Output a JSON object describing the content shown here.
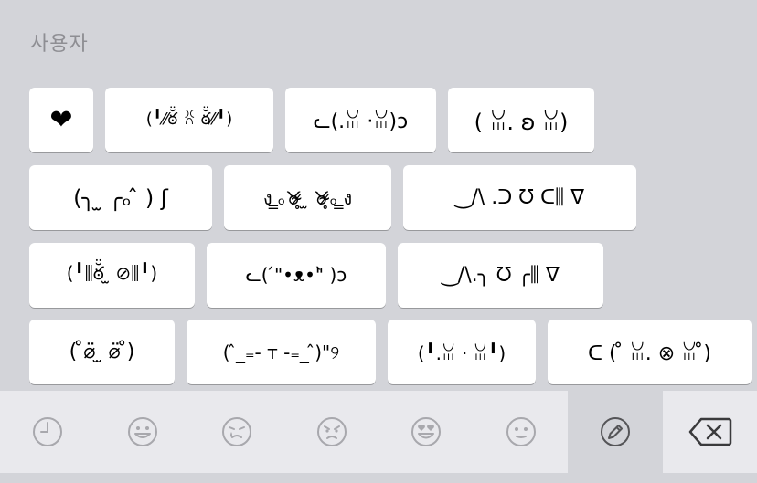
{
  "section": {
    "title": "사용자"
  },
  "emoticons": [
    "❤",
    "(╹⁄⁄ఠ̆̈ ꐦ ఠ̆̈⁄⁄╹)",
    "ᓚ(.ꈍ ·ꈍ)ↄ",
    "( ꈍ. ʚ ꈍ)",
    "(╮ ̫ ╭ₒ ̂ ) ʃ",
    "ง ̳ₒ♉̴̷̥ ̫ ♉̴̷̥ₒ ̳ง",
    "‿/\\ .ᑐ ᘮ ᑕ⫼ ᐁ",
    "(╹⫼ఠ̆̈ ̫ ⊘⫼╹)",
    "ᓚ( ́\"•ᴥ•\"̀ )ↄ",
    "‿/\\.╮ ᘮ ╭⫼ ᐁ",
    "( ̊⌀̈ ̫ ⌀̈ ̊)",
    "( ̂_₌- ᴛ -₌_ ̂)\"୨",
    "(╹.ꈍ · ꈍ╹)",
    "ᑕ ( ̊ ꈍ. ⊗ ꈍ ̊)"
  ],
  "toolbar": {
    "icons": [
      "clock-icon",
      "smile-icon",
      "crying-face-icon",
      "angry-face-icon",
      "heart-eyes-icon",
      "neutral-face-icon",
      "pencil-icon",
      "backspace-icon"
    ],
    "active_tab": "pencil-icon"
  }
}
